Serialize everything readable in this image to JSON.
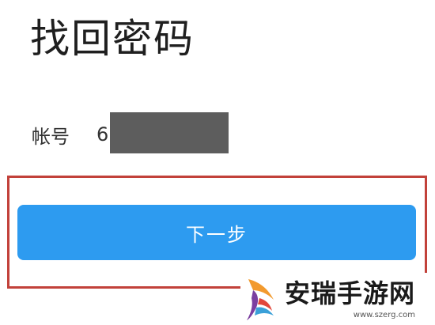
{
  "header": {
    "title": "找回密码"
  },
  "account": {
    "label": "帐号",
    "value_visible": "6"
  },
  "actions": {
    "next_label": "下一步"
  },
  "watermark": {
    "name": "安瑞手游网",
    "url": "www.szerg.com"
  },
  "colors": {
    "primary_button": "#2d9bf0",
    "highlight_border": "#c2413a",
    "mask": "#5d5d5d"
  }
}
